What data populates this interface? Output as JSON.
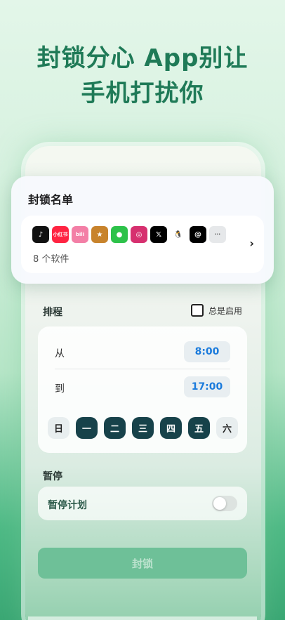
{
  "headline": {
    "line1": "封锁分心 App别让",
    "line2": "手机打扰你"
  },
  "block_list": {
    "title": "封锁名单",
    "apps": [
      {
        "icon": "tiktok-icon",
        "glyph": "♪",
        "color": "#111111"
      },
      {
        "icon": "xiaohongshu-icon",
        "glyph": "小红书",
        "color": "#ff2442"
      },
      {
        "icon": "bilibili-icon",
        "glyph": "bili",
        "color": "#f37fa6"
      },
      {
        "icon": "game-icon",
        "glyph": "★",
        "color": "#c8832c"
      },
      {
        "icon": "wechat-icon",
        "glyph": "●",
        "color": "#2dc24a"
      },
      {
        "icon": "instagram-icon",
        "glyph": "◎",
        "color": "#d6306f"
      },
      {
        "icon": "x-icon",
        "glyph": "𝕏",
        "color": "#000000"
      },
      {
        "icon": "qq-icon",
        "glyph": "🐧",
        "color": "#ffffff"
      },
      {
        "icon": "threads-icon",
        "glyph": "@",
        "color": "#000000"
      },
      {
        "icon": "more-icon",
        "glyph": "···",
        "color": "#e6e8ea"
      }
    ],
    "count_label": "8 个软件"
  },
  "schedule": {
    "title": "排程",
    "always_label": "总是启用",
    "from_label": "从",
    "from_time": "8:00",
    "to_label": "到",
    "to_time": "17:00",
    "days": [
      {
        "label": "日",
        "on": false
      },
      {
        "label": "一",
        "on": true
      },
      {
        "label": "二",
        "on": true
      },
      {
        "label": "三",
        "on": true
      },
      {
        "label": "四",
        "on": true
      },
      {
        "label": "五",
        "on": true
      },
      {
        "label": "六",
        "on": false
      }
    ]
  },
  "pause": {
    "title": "暂停",
    "plan_label": "暂停计划",
    "enabled": false
  },
  "actions": {
    "block_label": "封锁"
  }
}
